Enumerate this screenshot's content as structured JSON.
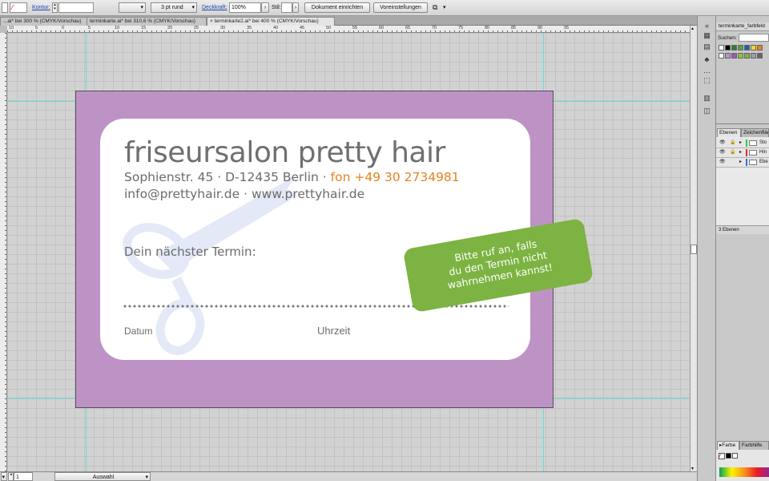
{
  "control_bar": {
    "stroke_label": "Kontur:",
    "stroke_weight": "",
    "stroke_profile": "",
    "brush": "3 pt rund",
    "opacity_label": "Deckkraft:",
    "opacity_value": "100%",
    "style_label": "Stil:",
    "document_setup_button": "Dokument einrichten",
    "preferences_button": "Voreinstellungen"
  },
  "tabs": [
    {
      "label": "...ai* bei 300 % (CMYK/Vorschau)",
      "active": false
    },
    {
      "label": "terminkarte.ai* bei 310,6 % (CMYK/Vorschau)",
      "active": false
    },
    {
      "label": "terminkarte2.ai* bei 400 % (CMYK/Vorschau)",
      "active": true
    }
  ],
  "ruler_numbers": [
    "10",
    "5",
    "0",
    "5",
    "10",
    "15",
    "20",
    "25",
    "30",
    "35",
    "40",
    "45",
    "50",
    "55",
    "60",
    "65",
    "70",
    "75",
    "80",
    "85",
    "90",
    "95"
  ],
  "card": {
    "salon_name": "friseursalon pretty hair",
    "address": "Sophienstr. 45 · D-12435 Berlin · ",
    "phone": "fon +49 30 2734981",
    "web": "info@prettyhair.de · www.prettyhair.de",
    "next_appointment": "Dein nächster Termin:",
    "date_label": "Datum",
    "time_label": "Uhrzeit",
    "sticker_lines": [
      "Bitte ruf an, falls",
      "du den Termin nicht",
      "wahrnehmen kannst!"
    ],
    "colors": {
      "background": "#bd93c5",
      "sticker": "#7cb342",
      "accent": "#e7821e",
      "text": "#6b6b6d"
    }
  },
  "status_bar": {
    "zoom_page": "1",
    "tool": "Auswahl"
  },
  "swatches_panel": {
    "title": "terminkarte_farbfeld",
    "search_label": "Suchen:",
    "search_value": "",
    "colors": [
      "#ffffff",
      "#000000",
      "#2e7d32",
      "#5e9e3c",
      "#1a5fb4",
      "#f6d32d",
      "#e7821e",
      "#ffffff",
      "#bd93c5",
      "#9b59b6",
      "#8bc34a",
      "#7cb342",
      "#9e9e9e",
      "#666666"
    ]
  },
  "layers_panel": {
    "tab_layers": "Ebenen",
    "tab_artboards": "Zeichenfläche",
    "layers": [
      {
        "name": "Sto",
        "color": "#2ecc40"
      },
      {
        "name": "Hin",
        "color": "#e03030"
      },
      {
        "name": "Ebe",
        "color": "#3a6fd8"
      }
    ],
    "count": "3 Ebenen"
  },
  "color_panel": {
    "tab_color": "Farbe",
    "tab_guide": "Farbhilfe"
  }
}
